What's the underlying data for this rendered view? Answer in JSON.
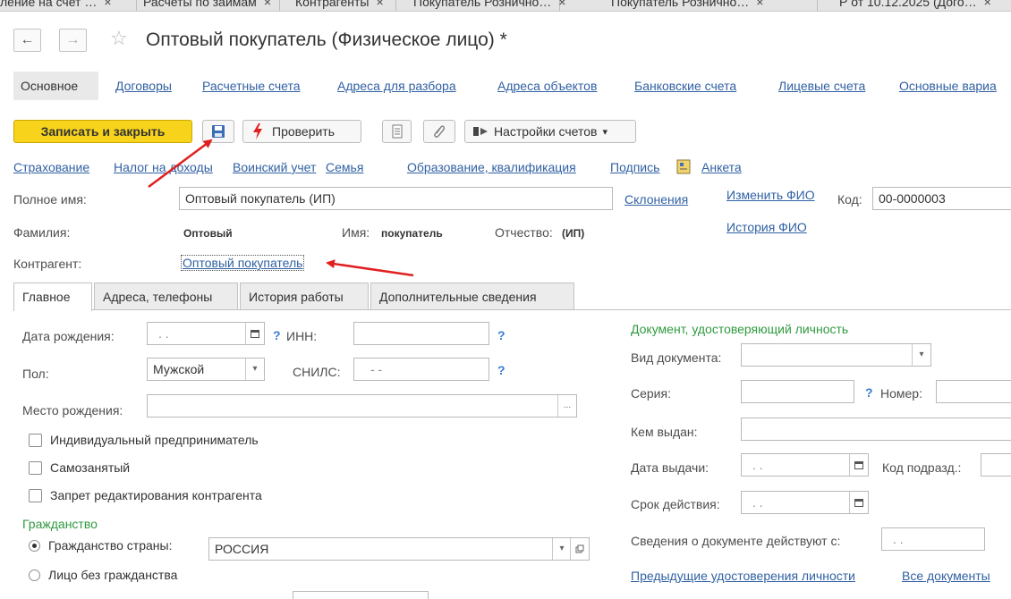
{
  "window_tabs": [
    {
      "label": "ление на счет …",
      "close": "×"
    },
    {
      "label": "Расчеты по займам",
      "close": "×"
    },
    {
      "label": "Контрагенты",
      "close": "×"
    },
    {
      "label": "Покупатель Рознично…",
      "close": "×"
    },
    {
      "label": "Покупатель Рознично…",
      "close": "×"
    },
    {
      "label": "Р от 10.12.2025 (Дого…",
      "close": "×"
    }
  ],
  "nav": {
    "back": "←",
    "forward": "→",
    "star": "☆"
  },
  "title": "Оптовый покупатель (Физическое лицо) *",
  "sections": [
    "Основное",
    "Договоры",
    "Расчетные счета",
    "Адреса для разбора",
    "Адреса объектов",
    "Банковские счета",
    "Лицевые счета",
    "Основные вариа"
  ],
  "toolbar": {
    "save_close": "Записать и закрыть",
    "check": "Проверить",
    "account_settings": "Настройки счетов",
    "dropdown_arrow": "▾"
  },
  "links_row": [
    "Страхование",
    "Налог на доходы",
    "Воинский учет",
    "Семья",
    "Образование, квалификация",
    "Подпись",
    "Анкета"
  ],
  "form": {
    "full_name_label": "Полное имя:",
    "full_name_value": "Оптовый покупатель (ИП)",
    "declensions": "Склонения",
    "change_fio": "Изменить ФИО",
    "code_label": "Код:",
    "code_value": "00-0000003",
    "fio_history": "История ФИО",
    "lastname_label": "Фамилия:",
    "lastname_value": "Оптовый",
    "firstname_label": "Имя:",
    "firstname_value": "покупатель",
    "patronymic_label": "Отчество:",
    "patronymic_value": "(ИП)",
    "counterparty_label": "Контрагент:",
    "counterparty_value": "Оптовый покупатель"
  },
  "tabs": [
    "Главное",
    "Адреса, телефоны",
    "История работы",
    "Дополнительные сведения"
  ],
  "main": {
    "birth_date_label": "Дата рождения:",
    "birth_date_value": ". .",
    "inn_label": "ИНН:",
    "help": "?",
    "gender_label": "Пол:",
    "gender_value": "Мужской",
    "snils_label": "СНИЛС:",
    "snils_value": "- -",
    "birth_place_label": "Место рождения:",
    "ellipsis": "...",
    "cb_ip": "Индивидуальный предприниматель",
    "cb_selfemployed": "Самозанятый",
    "cb_lock": "Запрет редактирования контрагента",
    "citizenship_header": "Гражданство",
    "radio_country": "Гражданство страны:",
    "country_value": "РОССИЯ",
    "radio_stateless": "Лицо без гражданства"
  },
  "id_doc": {
    "header": "Документ, удостоверяющий личность",
    "doc_type_label": "Вид документа:",
    "series_label": "Серия:",
    "number_label": "Номер:",
    "issued_by_label": "Кем выдан:",
    "issue_date_label": "Дата выдачи:",
    "issue_date_value": ". .",
    "dept_code_label": "Код подразд.:",
    "valid_until_label": "Срок действия:",
    "valid_until_value": ". .",
    "valid_from_label": "Сведения о документе действуют с:",
    "valid_from_value": ". .",
    "prev_docs": "Предыдущие удостоверения личности",
    "all_docs": "Все документы"
  },
  "colors": {
    "accent_yellow": "#f7d31b",
    "link": "#3161a3",
    "green": "#2f9a3f",
    "arrow": "#e02020"
  }
}
